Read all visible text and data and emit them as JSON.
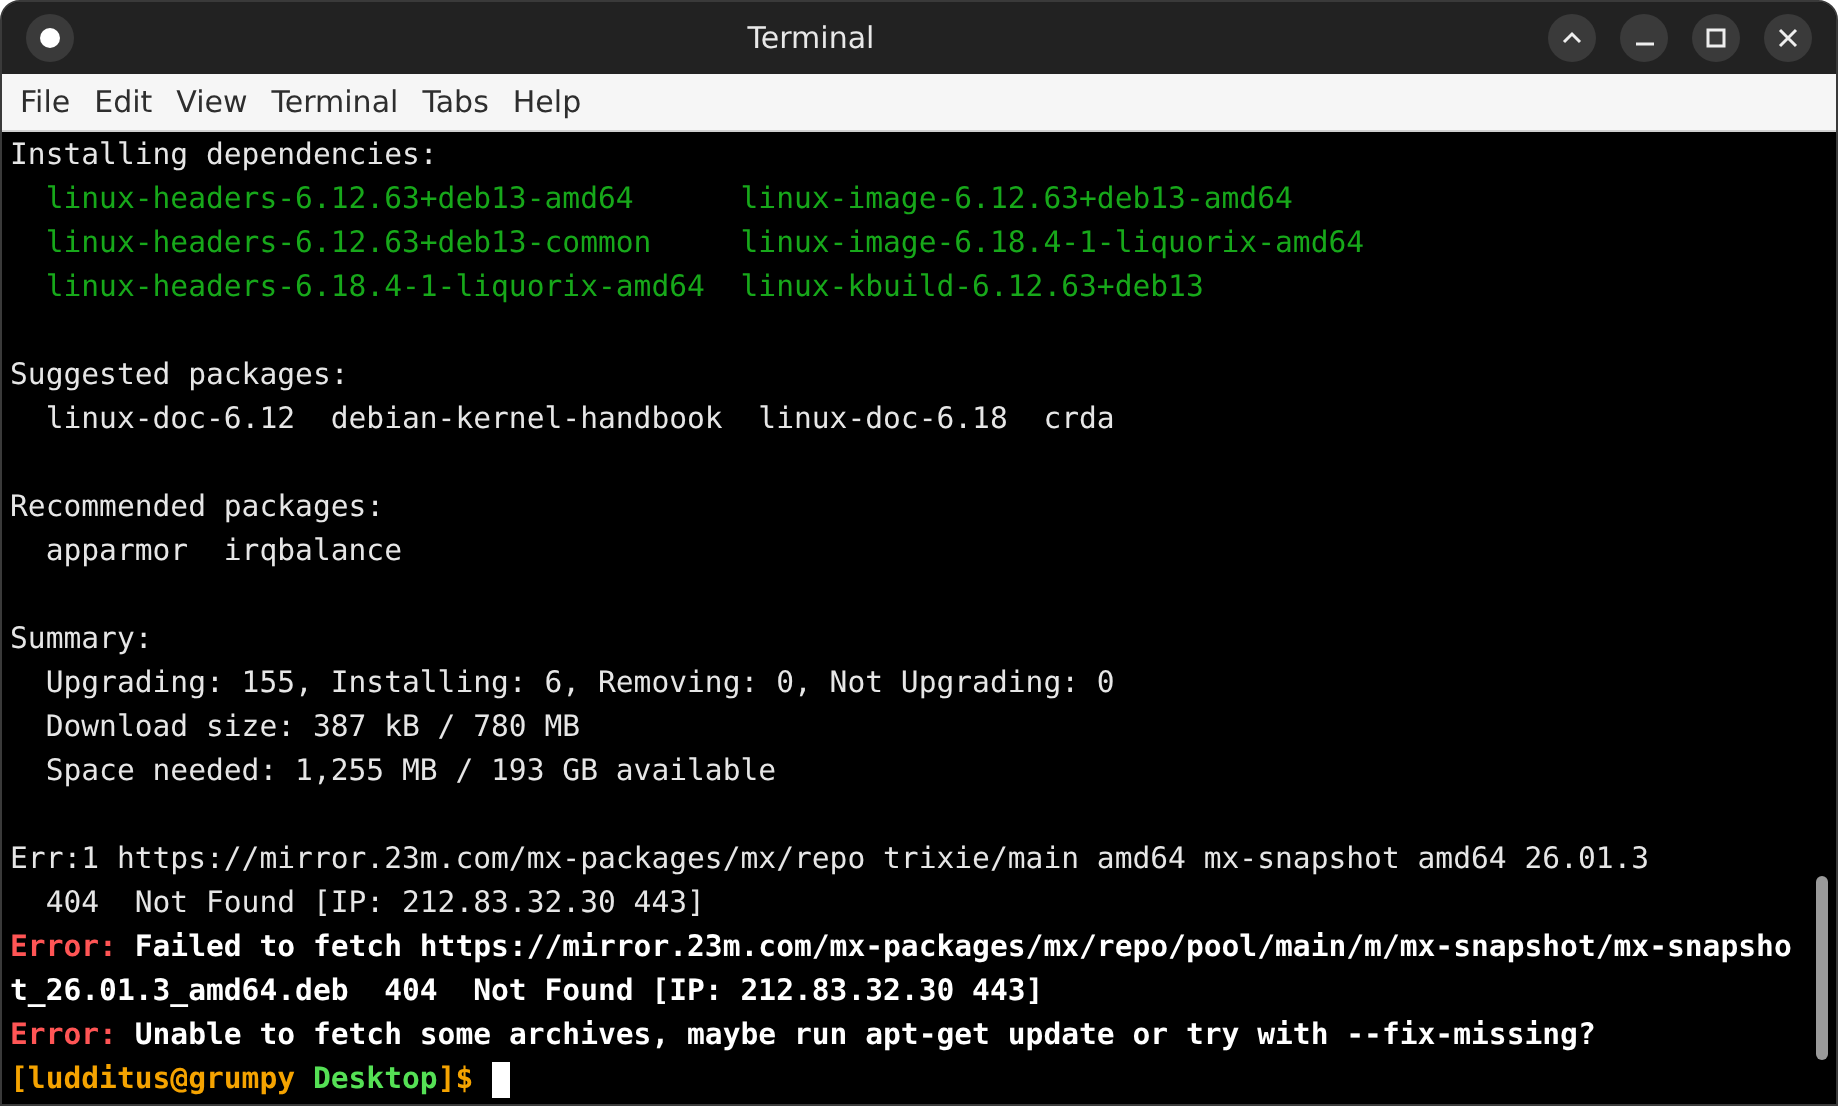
{
  "window": {
    "title": "Terminal"
  },
  "menu": [
    "File",
    "Edit",
    "View",
    "Terminal",
    "Tabs",
    "Help"
  ],
  "terminal": {
    "lines": [
      {
        "kind": "text",
        "segments": [
          {
            "kind": "plain",
            "text": "Installing dependencies:"
          }
        ]
      },
      {
        "kind": "text",
        "segments": [
          {
            "kind": "package",
            "text": "  linux-headers-6.12.63+deb13-amd64      linux-image-6.12.63+deb13-amd64"
          }
        ]
      },
      {
        "kind": "text",
        "segments": [
          {
            "kind": "package",
            "text": "  linux-headers-6.12.63+deb13-common     linux-image-6.18.4-1-liquorix-amd64"
          }
        ]
      },
      {
        "kind": "text",
        "segments": [
          {
            "kind": "package",
            "text": "  linux-headers-6.18.4-1-liquorix-amd64  linux-kbuild-6.12.63+deb13"
          }
        ]
      },
      {
        "kind": "blank"
      },
      {
        "kind": "text",
        "segments": [
          {
            "kind": "plain",
            "text": "Suggested packages:"
          }
        ]
      },
      {
        "kind": "text",
        "segments": [
          {
            "kind": "plain",
            "text": "  linux-doc-6.12  debian-kernel-handbook  linux-doc-6.18  crda"
          }
        ]
      },
      {
        "kind": "blank"
      },
      {
        "kind": "text",
        "segments": [
          {
            "kind": "plain",
            "text": "Recommended packages:"
          }
        ]
      },
      {
        "kind": "text",
        "segments": [
          {
            "kind": "plain",
            "text": "  apparmor  irqbalance"
          }
        ]
      },
      {
        "kind": "blank"
      },
      {
        "kind": "text",
        "segments": [
          {
            "kind": "plain",
            "text": "Summary:"
          }
        ]
      },
      {
        "kind": "text",
        "segments": [
          {
            "kind": "plain",
            "text": "  Upgrading: 155, Installing: 6, Removing: 0, Not Upgrading: 0"
          }
        ]
      },
      {
        "kind": "text",
        "segments": [
          {
            "kind": "plain",
            "text": "  Download size: 387 kB / 780 MB"
          }
        ]
      },
      {
        "kind": "text",
        "segments": [
          {
            "kind": "plain",
            "text": "  Space needed: 1,255 MB / 193 GB available"
          }
        ]
      },
      {
        "kind": "blank"
      },
      {
        "kind": "text",
        "segments": [
          {
            "kind": "plain",
            "text": "Err:1 https://mirror.23m.com/mx-packages/mx/repo trixie/main amd64 mx-snapshot amd64 26.01.3"
          }
        ]
      },
      {
        "kind": "text",
        "segments": [
          {
            "kind": "plain",
            "text": "  404  Not Found [IP: 212.83.32.30 443]"
          }
        ]
      },
      {
        "kind": "text",
        "segments": [
          {
            "kind": "error_label",
            "text": "Error:"
          },
          {
            "kind": "error_text",
            "text": " Failed to fetch https://mirror.23m.com/mx-packages/mx/repo/pool/main/m/mx-snapshot/mx-snapsho"
          }
        ]
      },
      {
        "kind": "text",
        "segments": [
          {
            "kind": "error_text",
            "text": "t_26.01.3_amd64.deb  404  Not Found [IP: 212.83.32.30 443]"
          }
        ]
      },
      {
        "kind": "text",
        "segments": [
          {
            "kind": "error_label",
            "text": "Error:"
          },
          {
            "kind": "error_text",
            "text": " Unable to fetch some archives, maybe run apt-get update or try with --fix-missing?"
          }
        ]
      },
      {
        "kind": "text",
        "segments": [
          {
            "kind": "prompt",
            "text": "[ludditus@grumpy "
          },
          {
            "kind": "cwd",
            "text": "Desktop"
          },
          {
            "kind": "prompt",
            "text": "]$"
          },
          {
            "kind": "cursor"
          }
        ]
      }
    ]
  }
}
